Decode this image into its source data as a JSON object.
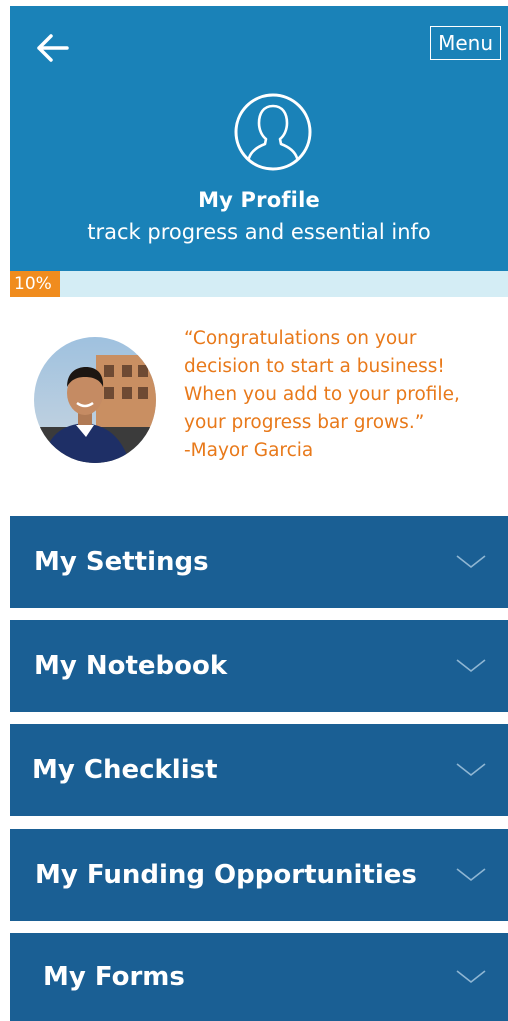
{
  "header": {
    "back_icon": "arrow-left-icon",
    "menu_label": "Menu",
    "profile_icon": "user-profile-icon",
    "title": "My Profile",
    "subtitle": "track progress and essential info"
  },
  "progress": {
    "label": "10%",
    "value": 0.1,
    "fill_color": "#f08c1e",
    "track_color": "#d4edf5"
  },
  "quote": {
    "text": "“Congratulations on your\ndecision to start a business!\nWhen you add to your profile,\nyour progress bar grows.”\n-Mayor Garcia",
    "color": "#e8791a"
  },
  "sections": [
    {
      "label": "My Settings"
    },
    {
      "label": "My Notebook"
    },
    {
      "label": "My Checklist"
    },
    {
      "label": "My Funding Opportunities"
    },
    {
      "label": "My Forms"
    }
  ],
  "colors": {
    "header_bg": "#1a82b8",
    "section_bg": "#1a5f94"
  }
}
